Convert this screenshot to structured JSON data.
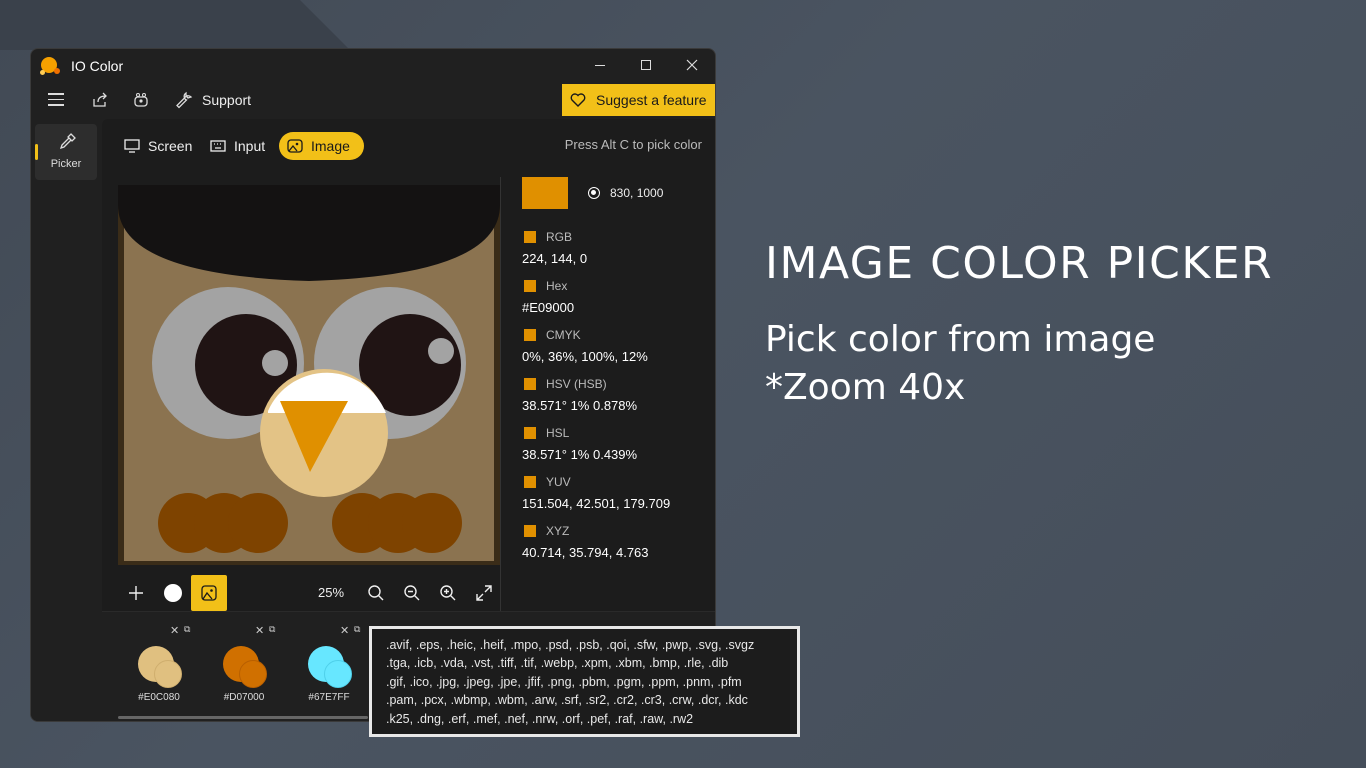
{
  "window": {
    "title": "IO Color"
  },
  "toolbar": {
    "support_label": "Support",
    "suggest_label": "Suggest a feature"
  },
  "sidebar": {
    "picker_label": "Picker"
  },
  "modes": {
    "screen": "Screen",
    "input": "Input",
    "image": "Image",
    "active": "image"
  },
  "hint": "Press Alt C to pick color",
  "picked": {
    "color": "#E09000",
    "coords": "830, 1000"
  },
  "formats": [
    {
      "name": "RGB",
      "value": "224, 144, 0"
    },
    {
      "name": "Hex",
      "value": "#E09000"
    },
    {
      "name": "CMYK",
      "value": "0%, 36%, 100%, 12%"
    },
    {
      "name": "HSV (HSB)",
      "value": "38.571° 1% 0.878%"
    },
    {
      "name": "HSL",
      "value": "38.571° 1% 0.439%"
    },
    {
      "name": "YUV",
      "value": "151.504, 42.501, 179.709"
    },
    {
      "name": "XYZ",
      "value": "40.714, 35.794, 4.763"
    }
  ],
  "zoom_level": "25%",
  "saved_colors": [
    {
      "hex": "#E0C080",
      "color": "#E0C080"
    },
    {
      "hex": "#D07000",
      "color": "#D07000"
    },
    {
      "hex": "#67E7FF",
      "color": "#67E7FF"
    }
  ],
  "tooltip_lines": [
    ".avif, .eps, .heic, .heif, .mpo, .psd, .psb, .qoi, .sfw, .pwp, .svg, .svgz",
    ".tga, .icb, .vda, .vst, .tiff, .tif, .webp, .xpm, .xbm, .bmp, .rle, .dib",
    ".gif, .ico, .jpg, .jpeg, .jpe, .jfif, .png, .pbm, .pgm, .ppm, .pnm, .pfm",
    ".pam, .pcx, .wbmp, .wbm, .arw, .srf, .sr2, .cr2, .cr3, .crw, .dcr, .kdc",
    ".k25, .dng, .erf, .mef, .nef, .nrw, .orf, .pef, .raf, .raw, .rw2"
  ],
  "promo": {
    "title": "IMAGE COLOR PICKER",
    "line1": "Pick color from image",
    "line2": "*Zoom 40x"
  },
  "colors": {
    "accent": "#F2C018",
    "window_bg": "#202020",
    "owl_body": "#8B7350",
    "owl_hat": "#141212",
    "owl_eye_ring": "#A3A3A3",
    "owl_pupil": "#201414",
    "owl_beak": "#E09000",
    "owl_feet": "#7E4300"
  }
}
